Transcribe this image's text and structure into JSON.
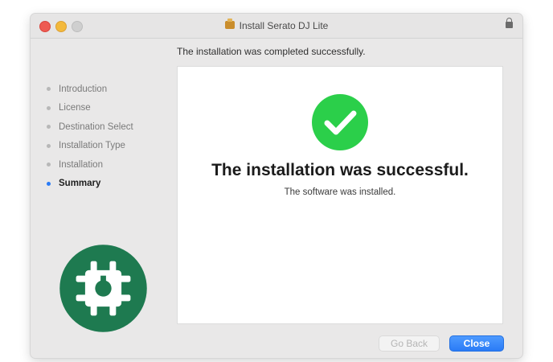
{
  "window": {
    "title": "Install Serato DJ Lite",
    "title_icon": "package-icon",
    "lock_icon": "lock-icon"
  },
  "header": {
    "text": "The installation was completed successfully."
  },
  "sidebar": {
    "steps": [
      {
        "label": "Introduction",
        "active": false
      },
      {
        "label": "License",
        "active": false
      },
      {
        "label": "Destination Select",
        "active": false
      },
      {
        "label": "Installation Type",
        "active": false
      },
      {
        "label": "Installation",
        "active": false
      },
      {
        "label": "Summary",
        "active": true
      }
    ],
    "logo_icon": "serato-logo-icon"
  },
  "main": {
    "status_icon": "checkmark-icon",
    "title": "The installation was successful.",
    "subtitle": "The software was installed."
  },
  "buttons": {
    "back_label": "Go Back",
    "close_label": "Close"
  },
  "colors": {
    "accent": "#2a7bf6",
    "success": "#2bcf4a",
    "logo": "#1e7a50"
  }
}
